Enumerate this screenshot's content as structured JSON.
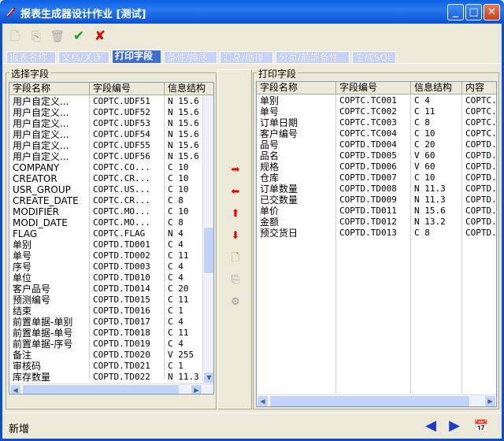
{
  "window": {
    "title": "报表生成器设计作业 [测试]",
    "minimize": "_",
    "maximize": "□",
    "close": "✕"
  },
  "toolbar": {
    "new": "🗋",
    "copy": "⎘",
    "delete": "🗑",
    "confirm": "✔",
    "cancel": "✘"
  },
  "tabs": [
    "报表名称",
    "文档/关连",
    "打印字段",
    "条件/排序",
    "汇总/缩排",
    "分页/前端条件",
    "生成SQL"
  ],
  "active_tab": 2,
  "left": {
    "group_label": "选择字段",
    "headers": [
      "字段名称",
      "字段编号",
      "信息结构"
    ],
    "rows": [
      [
        "用户自定义...",
        "COPTC.UDF51",
        "N 15.6"
      ],
      [
        "用户自定义...",
        "COPTC.UDF52",
        "N 15.6"
      ],
      [
        "用户自定义...",
        "COPTC.UDF53",
        "N 15.6"
      ],
      [
        "用户自定义...",
        "COPTC.UDF54",
        "N 15.6"
      ],
      [
        "用户自定义...",
        "COPTC.UDF55",
        "N 15.6"
      ],
      [
        "用户自定义...",
        "COPTC.UDF56",
        "N 15.6"
      ],
      [
        "COMPANY",
        "COPTC.CO...",
        "C 10"
      ],
      [
        "CREATOR",
        "COPTC.CR...",
        "C 10"
      ],
      [
        "USR_GROUP",
        "COPTC.US...",
        "C 10"
      ],
      [
        "CREATE_DATE",
        "COPTC.CR...",
        "C 8"
      ],
      [
        "MODIFIER",
        "COPTC.MO...",
        "C 10"
      ],
      [
        "MODI_DATE",
        "COPTC.MO...",
        "C 8"
      ],
      [
        "FLAG",
        "COPTC.FLAG",
        "N 4"
      ],
      [
        "单别",
        "COPTD.TD001",
        "C 4"
      ],
      [
        "单号",
        "COPTD.TD002",
        "C 11"
      ],
      [
        "序号",
        "COPTD.TD003",
        "C 4"
      ],
      [
        "单位",
        "COPTD.TD010",
        "C 4"
      ],
      [
        "客户品号",
        "COPTD.TD014",
        "C 20"
      ],
      [
        "预测编号",
        "COPTD.TD015",
        "C 11"
      ],
      [
        "结束",
        "COPTD.TD016",
        "C 1"
      ],
      [
        "前置单据-单别",
        "COPTD.TD017",
        "C 4"
      ],
      [
        "前置单据-单号",
        "COPTD.TD018",
        "C 11"
      ],
      [
        "前置单据-序号",
        "COPTD.TD019",
        "C 4"
      ],
      [
        "备注",
        "COPTD.TD020",
        "V 255"
      ],
      [
        "审核码",
        "COPTD.TD021",
        "C 1"
      ],
      [
        "库存数量",
        "COPTD.TD022",
        "N 11.3"
      ]
    ]
  },
  "right": {
    "group_label": "打印字段",
    "headers": [
      "字段名称",
      "字段编号",
      "信息结构",
      "内容"
    ],
    "rows": [
      [
        "单别",
        "COPTC.TC001",
        "C 4",
        "COPTC."
      ],
      [
        "单号",
        "COPTC.TC002",
        "C 11",
        "COPTC."
      ],
      [
        "订单日期",
        "COPTC.TC003",
        "C 8",
        "COPTC."
      ],
      [
        "客户编号",
        "COPTC.TC004",
        "C 10",
        "COPTC."
      ],
      [
        "品号",
        "COPTD.TD004",
        "C 20",
        "COPTD."
      ],
      [
        "品名",
        "COPTD.TD005",
        "V 60",
        "COPTD."
      ],
      [
        "规格",
        "COPTD.TD006",
        "V 60",
        "COPTD."
      ],
      [
        "仓库",
        "COPTD.TD007",
        "C 10",
        "COPTD."
      ],
      [
        "订单数量",
        "COPTD.TD008",
        "N 11.3",
        "COPTD."
      ],
      [
        "已交数量",
        "COPTD.TD009",
        "N 11.3",
        "COPTD."
      ],
      [
        "单价",
        "COPTD.TD011",
        "N 15.6",
        "COPTD."
      ],
      [
        "金额",
        "COPTD.TD012",
        "N 13.2",
        "COPTD."
      ],
      [
        "预交货日",
        "COPTD.TD013",
        "C 8",
        "COPTD."
      ]
    ]
  },
  "middle": {
    "add": "➡",
    "remove": "⬅",
    "up": "⬆",
    "down": "⬇",
    "new": "🗋",
    "copy": "⎘",
    "tree": "⚙"
  },
  "colors": {
    "titlebar": "#0a5fe0",
    "accent_red": "#e00000",
    "check_green": "#1a9a1a"
  },
  "status": {
    "text": "新增",
    "prev": "◀",
    "next": "▶",
    "calendar": "📅"
  }
}
